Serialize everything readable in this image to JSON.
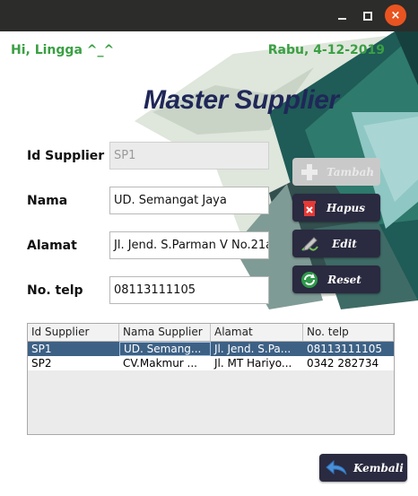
{
  "window": {
    "close_glyph": "×"
  },
  "header": {
    "greeting": "Hi, Lingga ^_^",
    "date": "Rabu, 4-12-2019",
    "title": "Master Supplier"
  },
  "form": {
    "id_label": "Id Supplier",
    "id_value": "SP1",
    "nama_label": "Nama",
    "nama_value": "UD. Semangat Jaya",
    "alamat_label": "Alamat",
    "alamat_value": "Jl. Jend. S.Parman V No.21a",
    "telp_label": "No. telp",
    "telp_value": "08113111105"
  },
  "buttons": {
    "tambah": "Tambah",
    "hapus": "Hapus",
    "edit": "Edit",
    "reset": "Reset",
    "kembali": "Kembali"
  },
  "table": {
    "headers": [
      "Id Supplier",
      "Nama Supplier",
      "Alamat",
      "No. telp"
    ],
    "rows": [
      [
        "SP1",
        "UD. Semang...",
        "Jl. Jend. S.Pa...",
        "08113111105"
      ],
      [
        "SP2",
        "CV.Makmur ...",
        "Jl. MT Hariyo...",
        "0342 282734"
      ]
    ],
    "selected_row": 0
  },
  "colors": {
    "accent_green": "#3aa043",
    "title_navy": "#1f2758",
    "button_dark": "#2a2a40",
    "selection": "#3d6185",
    "close_orange": "#e95420"
  },
  "icons": {
    "tambah": "plus-icon",
    "hapus": "trash-icon",
    "edit": "pencil-icon",
    "reset": "refresh-icon",
    "kembali": "back-arrow-icon"
  }
}
